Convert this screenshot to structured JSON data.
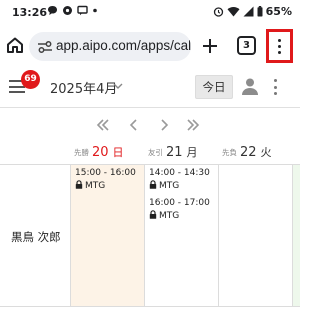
{
  "status_bar": {
    "time": "13:26",
    "battery": "65%"
  },
  "browser": {
    "url": "app.aipo.com/apps/calendar",
    "tab_count": "3"
  },
  "header": {
    "notification_count": "69",
    "month": "2025年4月",
    "today_label": "今日"
  },
  "week_nav": {
    "prev_week": "«",
    "prev_day": "‹",
    "next_day": "›",
    "next_week": "»"
  },
  "days": [
    {
      "rokuyo": "先勝",
      "date": "20",
      "weekday": "日"
    },
    {
      "rokuyo": "友引",
      "date": "21",
      "weekday": "月"
    },
    {
      "rokuyo": "先負",
      "date": "22",
      "weekday": "火"
    }
  ],
  "member": {
    "name": "黒鳥 次郎"
  },
  "events": [
    {
      "time": "15:00 - 16:00",
      "title": "MTG"
    },
    {
      "time": "14:00 - 14:30",
      "title": "MTG"
    },
    {
      "time": "16:00 - 17:00",
      "title": "MTG"
    }
  ],
  "colors": {
    "accent_red": "#e0191b",
    "sunday_column": "#fdf3e7",
    "url_pill": "#eef0f4"
  }
}
